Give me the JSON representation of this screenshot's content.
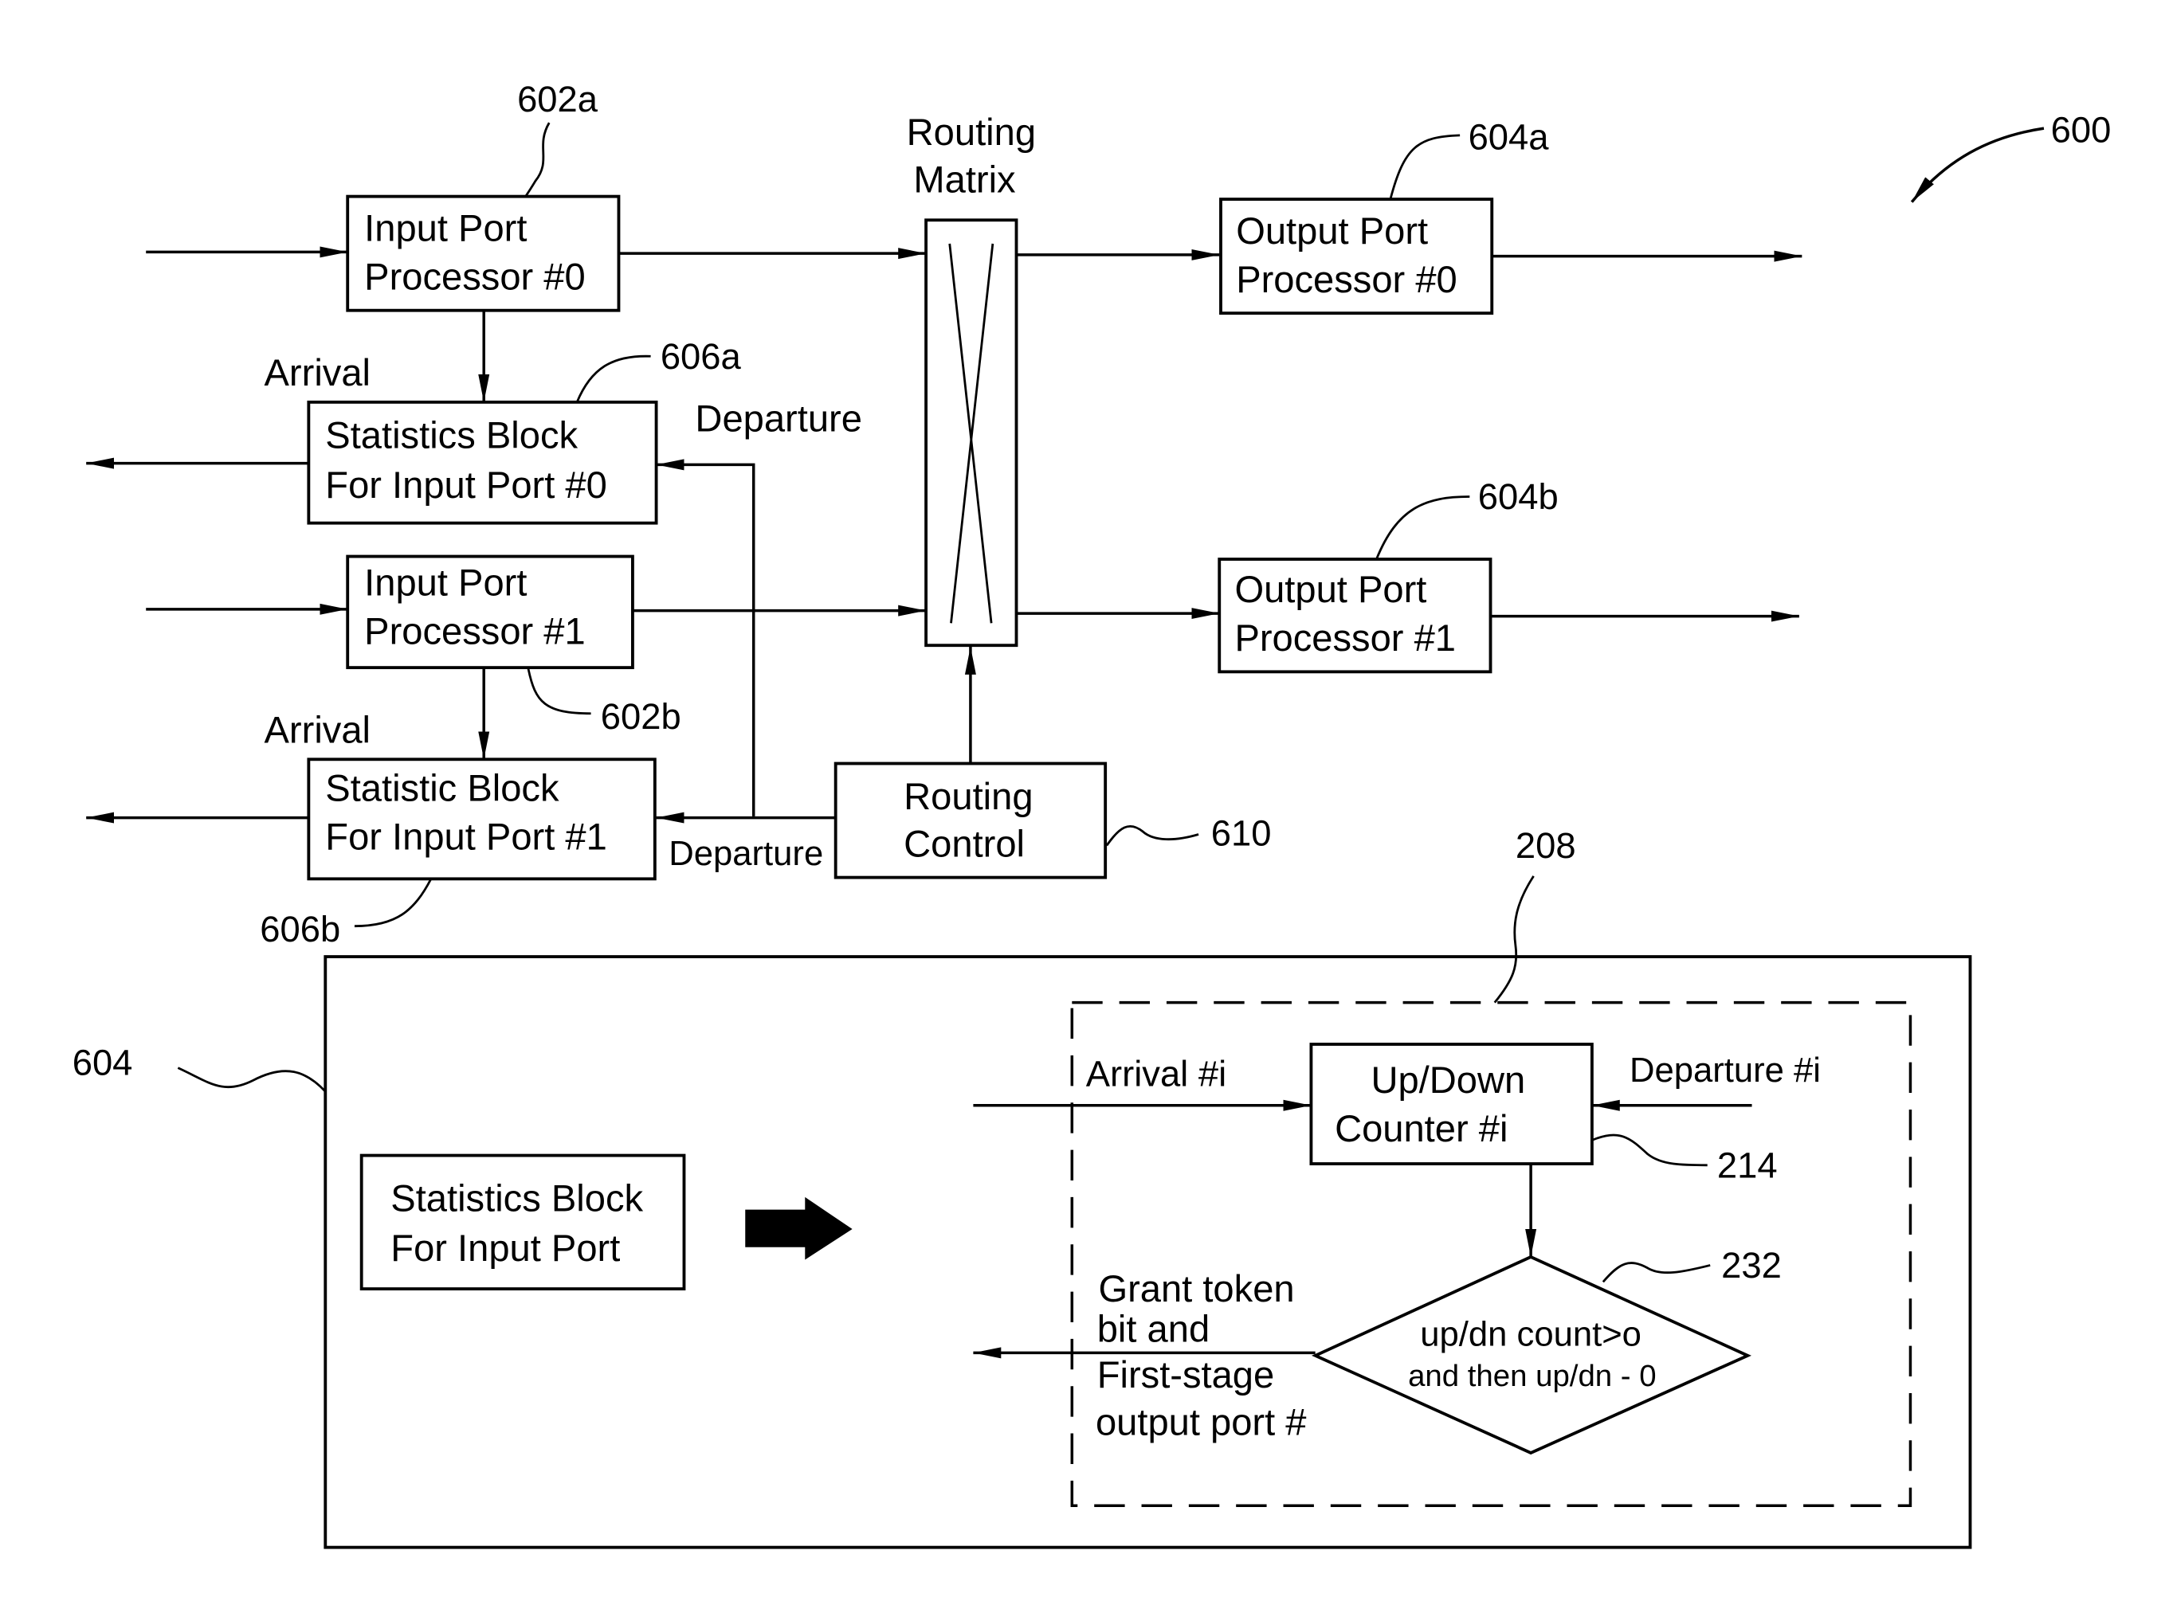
{
  "figure": {
    "ref": "600",
    "input_ports": [
      {
        "ref": "602a",
        "line1": "Input Port",
        "line2": "Processor #0"
      },
      {
        "ref": "602b",
        "line1": "Input Port",
        "line2": "Processor #1"
      }
    ],
    "stat_blocks": [
      {
        "ref": "606a",
        "line1": "Statistics Block",
        "line2": "For Input Port #0"
      },
      {
        "ref": "606b",
        "line1": "Statistic Block",
        "line2": "For Input Port #1"
      }
    ],
    "output_ports": [
      {
        "ref": "604a",
        "line1": "Output Port",
        "line2": "Processor #0"
      },
      {
        "ref": "604b",
        "line1": "Output Port",
        "line2": "Processor #1"
      }
    ],
    "routing_matrix": {
      "line1": "Routing",
      "line2": "Matrix"
    },
    "routing_control": {
      "ref": "610",
      "line1": "Routing",
      "line2": "Control"
    },
    "labels": {
      "arrival": "Arrival",
      "departure": "Departure"
    },
    "detail": {
      "ref": "604",
      "inner_ref": "208",
      "stat_block": {
        "line1": "Statistics Block",
        "line2": "For Input Port"
      },
      "arrival_i": "Arrival #i",
      "departure_i": "Departure #i",
      "counter": {
        "ref": "214",
        "line1": "Up/Down",
        "line2": "Counter #i"
      },
      "decision": {
        "ref": "232",
        "line1": "up/dn count>o",
        "line2": "and then up/dn - 0"
      },
      "output_label": [
        "Grant token",
        "bit and",
        "First-stage",
        "output port #"
      ]
    }
  }
}
